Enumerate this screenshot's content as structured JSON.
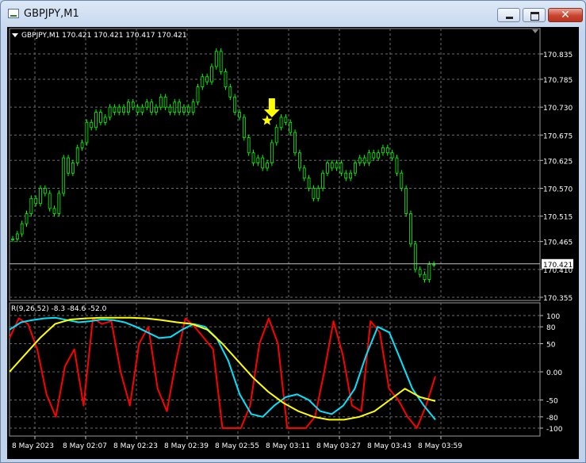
{
  "window": {
    "title": "GBPJPY,M1",
    "minimize_icon": "minimize-icon",
    "maximize_icon": "maximize-icon",
    "close_icon": "close-icon",
    "close_glyph": "✕"
  },
  "main_panel": {
    "header": "GBPJPY,M1  170.421 170.421 170.417 170.421",
    "price_labels": [
      "170.835",
      "170.785",
      "170.730",
      "170.675",
      "170.625",
      "170.570",
      "170.515",
      "170.465",
      "170.410",
      "170.355"
    ],
    "current_price": "170.421",
    "arrow_icon": "down-arrow-icon",
    "star_icon": "star-icon"
  },
  "indicator_panel": {
    "header": "R(9,26,52) -8.3 -84.6 -52.0",
    "level_labels": [
      "100",
      "80",
      "50",
      "0.00",
      "-50",
      "-80",
      "-100"
    ]
  },
  "time_axis": {
    "labels": [
      "8 May 2023",
      "8 May 02:07",
      "8 May 02:23",
      "8 May 02:39",
      "8 May 02:55",
      "8 May 03:11",
      "8 May 03:27",
      "8 May 03:43",
      "8 May 03:59"
    ]
  },
  "colors": {
    "background": "#000000",
    "grid": "#6b6b6b",
    "candle_bull": "#00ff00",
    "candle_bear": "#00ff00",
    "series_fast": "#ff0000",
    "series_mid": "#00e5ff",
    "series_slow": "#ffff00",
    "marker": "#ffff00"
  },
  "chart_data": [
    {
      "type": "line",
      "title": "GBPJPY,M1",
      "ylim": [
        170.355,
        170.86
      ],
      "series": [
        {
          "name": "",
          "values": [
            170.47,
            170.48,
            170.5,
            170.52,
            170.55,
            170.54,
            170.57,
            170.56,
            170.53,
            170.52,
            170.56,
            170.63,
            170.6,
            170.62,
            170.65,
            170.66,
            170.7,
            170.69,
            170.72,
            170.7,
            170.71,
            170.73,
            170.72,
            170.73,
            170.72,
            170.74,
            170.73,
            170.72,
            170.73,
            170.74,
            170.72,
            170.73,
            170.75,
            170.73,
            170.72,
            170.74,
            170.72,
            170.73,
            170.72,
            170.74,
            170.77,
            170.79,
            170.78,
            170.81,
            170.84,
            170.8,
            170.77,
            170.75,
            170.72,
            170.71,
            170.67,
            170.64,
            170.62,
            170.63,
            170.61,
            170.62,
            170.66,
            170.69,
            170.71,
            170.7,
            170.68,
            170.64,
            170.61,
            170.59,
            170.57,
            170.55,
            170.57,
            170.6,
            170.62,
            170.61,
            170.62,
            170.6,
            170.59,
            170.6,
            170.62,
            170.63,
            170.62,
            170.64,
            170.63,
            170.64,
            170.65,
            170.64,
            170.63,
            170.6,
            170.57,
            170.52,
            170.46,
            170.41,
            170.4,
            170.39,
            170.42,
            170.42
          ]
        }
      ]
    },
    {
      "type": "line",
      "title": "R(9,26,52)",
      "ylim": [
        -100,
        100
      ],
      "series": [
        {
          "name": "",
          "values": [
            60,
            95,
            85,
            40,
            -40,
            -80,
            10,
            40,
            -60,
            95,
            85,
            90,
            0,
            -60,
            50,
            80,
            -30,
            -70,
            20,
            95,
            80,
            60,
            40,
            -100,
            -100,
            -100,
            -60,
            50,
            95,
            50,
            -100,
            -100,
            -100,
            -80,
            0,
            90,
            30,
            -60,
            -70,
            90,
            70,
            -30,
            -50,
            -80,
            -100,
            -60,
            -8
          ]
        },
        {
          "name": "",
          "values": [
            75,
            88,
            92,
            95,
            96,
            92,
            88,
            90,
            93,
            92,
            88,
            80,
            70,
            60,
            62,
            75,
            85,
            80,
            60,
            20,
            -40,
            -75,
            -80,
            -60,
            -45,
            -40,
            -50,
            -70,
            -75,
            -60,
            -30,
            30,
            80,
            70,
            20,
            -30,
            -60,
            -85
          ]
        },
        {
          "name": "",
          "values": [
            0,
            30,
            60,
            85,
            93,
            95,
            96,
            96,
            96,
            95,
            92,
            88,
            85,
            75,
            50,
            20,
            -10,
            -35,
            -55,
            -70,
            -80,
            -85,
            -85,
            -80,
            -70,
            -50,
            -30,
            -45,
            -52
          ]
        }
      ]
    }
  ]
}
